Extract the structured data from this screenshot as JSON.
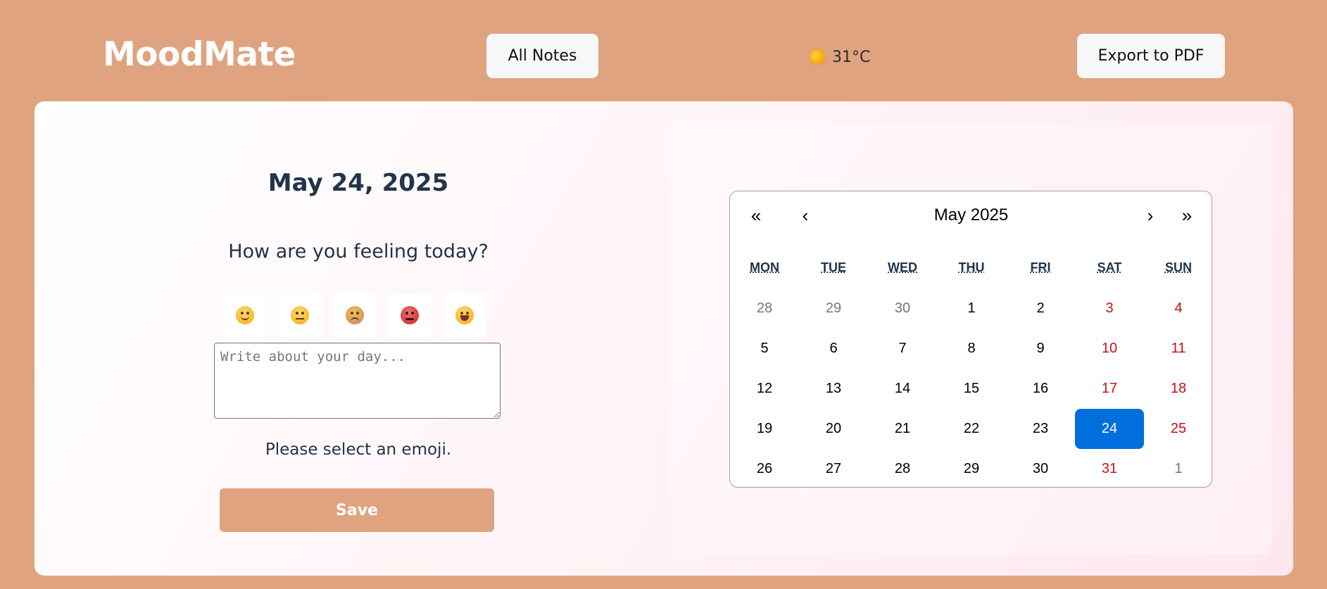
{
  "header": {
    "logo": "MoodMate",
    "all_notes_label": "All Notes",
    "weather_temp": "31°C",
    "weather_icon": "sun-icon",
    "export_label": "Export to PDF"
  },
  "entry": {
    "date_title": "May 24, 2025",
    "prompt": "How are you feeling today?",
    "emojis": [
      "smiling-face-icon",
      "neutral-face-icon",
      "sad-face-icon",
      "angry-face-icon",
      "grinning-face-icon"
    ],
    "journal_value": "",
    "journal_placeholder": "Write about your day...",
    "status": "Please select an emoji.",
    "save_label": "Save"
  },
  "calendar": {
    "nav": {
      "prev2": "«",
      "prev": "‹",
      "label": "May 2025",
      "next": "›",
      "next2": "»"
    },
    "weekdays": [
      "MON",
      "TUE",
      "WED",
      "THU",
      "FRI",
      "SAT",
      "SUN"
    ],
    "days": [
      {
        "d": "28",
        "type": "neighbor"
      },
      {
        "d": "29",
        "type": "neighbor"
      },
      {
        "d": "30",
        "type": "neighbor"
      },
      {
        "d": "1",
        "type": "normal"
      },
      {
        "d": "2",
        "type": "normal"
      },
      {
        "d": "3",
        "type": "weekend"
      },
      {
        "d": "4",
        "type": "weekend"
      },
      {
        "d": "5",
        "type": "normal"
      },
      {
        "d": "6",
        "type": "normal"
      },
      {
        "d": "7",
        "type": "normal"
      },
      {
        "d": "8",
        "type": "normal"
      },
      {
        "d": "9",
        "type": "normal"
      },
      {
        "d": "10",
        "type": "weekend"
      },
      {
        "d": "11",
        "type": "weekend"
      },
      {
        "d": "12",
        "type": "normal"
      },
      {
        "d": "13",
        "type": "normal"
      },
      {
        "d": "14",
        "type": "normal"
      },
      {
        "d": "15",
        "type": "normal"
      },
      {
        "d": "16",
        "type": "normal"
      },
      {
        "d": "17",
        "type": "weekend"
      },
      {
        "d": "18",
        "type": "weekend"
      },
      {
        "d": "19",
        "type": "normal"
      },
      {
        "d": "20",
        "type": "normal"
      },
      {
        "d": "21",
        "type": "normal"
      },
      {
        "d": "22",
        "type": "normal"
      },
      {
        "d": "23",
        "type": "normal"
      },
      {
        "d": "24",
        "type": "active"
      },
      {
        "d": "25",
        "type": "weekend"
      },
      {
        "d": "26",
        "type": "normal"
      },
      {
        "d": "27",
        "type": "normal"
      },
      {
        "d": "28",
        "type": "normal"
      },
      {
        "d": "29",
        "type": "normal"
      },
      {
        "d": "30",
        "type": "normal"
      },
      {
        "d": "31",
        "type": "weekend"
      },
      {
        "d": "1",
        "type": "neighbor"
      }
    ],
    "selected_color": "#006edc",
    "weekend_color": "#c41010"
  },
  "colors": {
    "background": "#DFA47F",
    "accent": "#DFA47F",
    "heading": "#22344a"
  }
}
